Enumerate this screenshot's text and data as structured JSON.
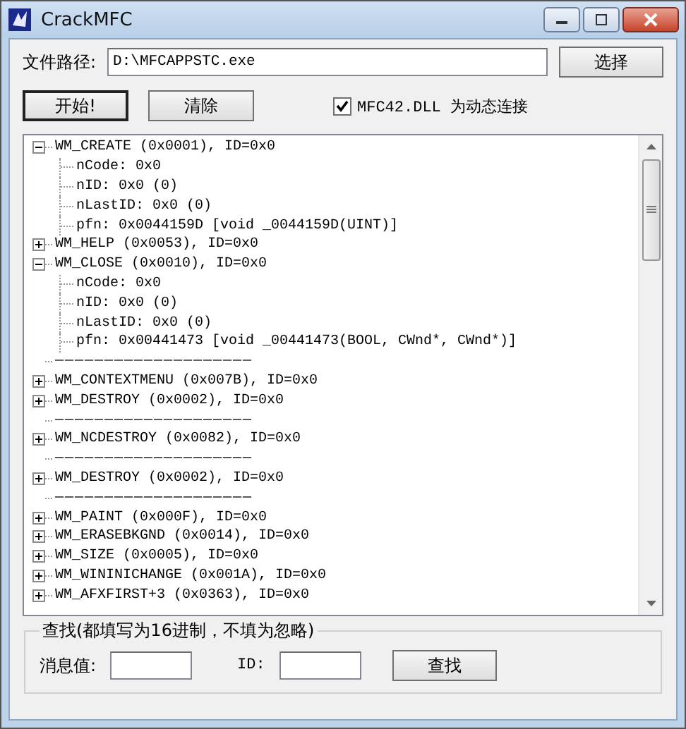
{
  "window": {
    "title": "CrackMFC"
  },
  "path": {
    "label": "文件路径:",
    "value": "D:\\MFCAPPSTC.exe",
    "button": "选择"
  },
  "actions": [
    {
      "label": "开始!",
      "focused": true
    },
    {
      "label": "清除",
      "focused": false
    }
  ],
  "dynamic_link": {
    "label": "MFC42.DLL 为动态连接",
    "checked": true
  },
  "tree": [
    {
      "kind": "message",
      "label": "WM_CREATE (0x0001), ID=0x0",
      "expanded": true,
      "children": [
        {
          "label": "nCode: 0x0"
        },
        {
          "label": "nID: 0x0 (0)"
        },
        {
          "label": "nLastID: 0x0 (0)"
        },
        {
          "label": "pfn: 0x0044159D [void _0044159D(UINT)]"
        }
      ]
    },
    {
      "kind": "message",
      "label": "WM_HELP (0x0053), ID=0x0",
      "expanded": false
    },
    {
      "kind": "message",
      "label": "WM_CLOSE (0x0010), ID=0x0",
      "expanded": true,
      "children": [
        {
          "label": "nCode: 0x0"
        },
        {
          "label": "nID: 0x0 (0)"
        },
        {
          "label": "nLastID: 0x0 (0)"
        },
        {
          "label": "pfn: 0x00441473 [void _00441473(BOOL, CWnd*, CWnd*)]"
        }
      ]
    },
    {
      "kind": "separator",
      "label": "————————————————————"
    },
    {
      "kind": "message",
      "label": "WM_CONTEXTMENU (0x007B), ID=0x0",
      "expanded": false
    },
    {
      "kind": "message",
      "label": "WM_DESTROY (0x0002), ID=0x0",
      "expanded": false
    },
    {
      "kind": "separator",
      "label": "————————————————————"
    },
    {
      "kind": "message",
      "label": "WM_NCDESTROY (0x0082), ID=0x0",
      "expanded": false
    },
    {
      "kind": "separator",
      "label": "————————————————————"
    },
    {
      "kind": "message",
      "label": "WM_DESTROY (0x0002), ID=0x0",
      "expanded": false
    },
    {
      "kind": "separator",
      "label": "————————————————————"
    },
    {
      "kind": "message",
      "label": "WM_PAINT (0x000F), ID=0x0",
      "expanded": false
    },
    {
      "kind": "message",
      "label": "WM_ERASEBKGND (0x0014), ID=0x0",
      "expanded": false
    },
    {
      "kind": "message",
      "label": "WM_SIZE (0x0005), ID=0x0",
      "expanded": false
    },
    {
      "kind": "message",
      "label": "WM_WININICHANGE (0x001A), ID=0x0",
      "expanded": false
    },
    {
      "kind": "message",
      "label": "WM_AFXFIRST+3 (0x0363), ID=0x0",
      "expanded": false
    }
  ],
  "search": {
    "legend": "查找(都填写为16进制，不填为忽略)",
    "message_label": "消息值:",
    "id_label": "ID:",
    "button": "查找"
  }
}
